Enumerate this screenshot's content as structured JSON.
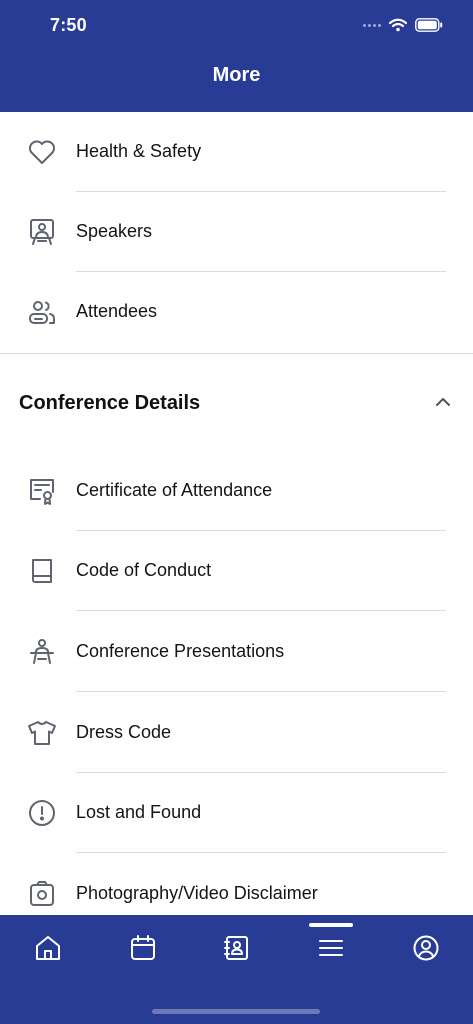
{
  "status": {
    "time": "7:50"
  },
  "header": {
    "title": "More"
  },
  "top_items": [
    {
      "label": "Health & Safety",
      "icon": "heart-icon"
    },
    {
      "label": "Speakers",
      "icon": "presenter-icon"
    },
    {
      "label": "Attendees",
      "icon": "users-icon"
    }
  ],
  "section": {
    "title": "Conference Details",
    "expanded": true,
    "items": [
      {
        "label": "Certificate of Attendance",
        "icon": "certificate-icon"
      },
      {
        "label": "Code of Conduct",
        "icon": "book-icon"
      },
      {
        "label": "Conference Presentations",
        "icon": "podium-icon"
      },
      {
        "label": "Dress Code",
        "icon": "shirt-icon"
      },
      {
        "label": "Lost and Found",
        "icon": "alert-circle-icon"
      },
      {
        "label": "Photography/Video Disclaimer",
        "icon": "camera-icon"
      }
    ]
  },
  "tabbar": {
    "tabs": [
      {
        "icon": "home-icon"
      },
      {
        "icon": "calendar-icon"
      },
      {
        "icon": "contact-book-icon"
      },
      {
        "icon": "menu-icon",
        "active": true
      },
      {
        "icon": "profile-icon"
      }
    ]
  },
  "colors": {
    "brand": "#283c96",
    "icon": "#5f6470",
    "divider": "#dcdcdc"
  }
}
